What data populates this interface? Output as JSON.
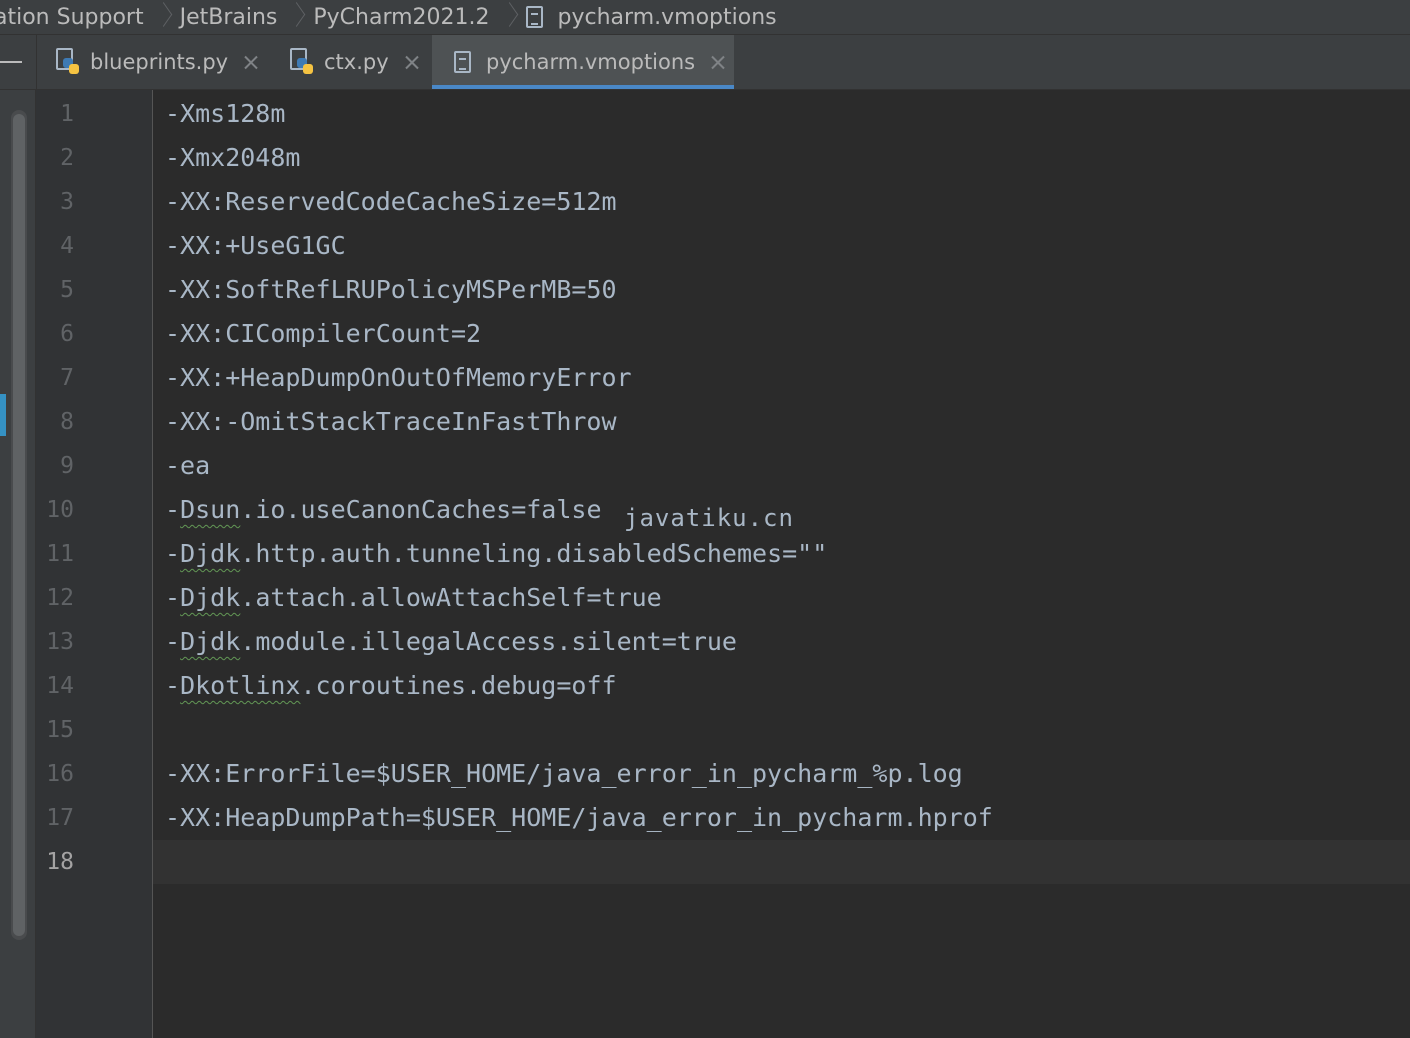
{
  "breadcrumb": {
    "items": [
      "ation Support",
      "JetBrains",
      "PyCharm2021.2",
      "pycharm.vmoptions"
    ]
  },
  "tabs": [
    {
      "label": "blueprints.py",
      "icon": "python-file-icon",
      "active": false
    },
    {
      "label": "ctx.py",
      "icon": "python-file-icon",
      "active": false
    },
    {
      "label": "pycharm.vmoptions",
      "icon": "text-file-icon",
      "active": true
    }
  ],
  "editor": {
    "current_line": "18",
    "line_numbers": [
      "1",
      "2",
      "3",
      "4",
      "5",
      "6",
      "7",
      "8",
      "9",
      "10",
      "11",
      "12",
      "13",
      "14",
      "15",
      "16",
      "17",
      "18"
    ],
    "lines": [
      {
        "prefix": "-Xms128m",
        "flagged": "",
        "rest": ""
      },
      {
        "prefix": "-Xmx2048m",
        "flagged": "",
        "rest": ""
      },
      {
        "prefix": "-XX:ReservedCodeCacheSize=512m",
        "flagged": "",
        "rest": ""
      },
      {
        "prefix": "-XX:+UseG1GC",
        "flagged": "",
        "rest": ""
      },
      {
        "prefix": "-XX:SoftRefLRUPolicyMSPerMB=50",
        "flagged": "",
        "rest": ""
      },
      {
        "prefix": "-XX:CICompilerCount=2",
        "flagged": "",
        "rest": ""
      },
      {
        "prefix": "-XX:+HeapDumpOnOutOfMemoryError",
        "flagged": "",
        "rest": ""
      },
      {
        "prefix": "-XX:-OmitStackTraceInFastThrow",
        "flagged": "",
        "rest": ""
      },
      {
        "prefix": "-ea",
        "flagged": "",
        "rest": ""
      },
      {
        "prefix": "-",
        "flagged": "Dsun",
        "rest": ".io.useCanonCaches=false"
      },
      {
        "prefix": "-",
        "flagged": "Djdk",
        "rest": ".http.auth.tunneling.disabledSchemes=\"\""
      },
      {
        "prefix": "-",
        "flagged": "Djdk",
        "rest": ".attach.allowAttachSelf=true"
      },
      {
        "prefix": "-",
        "flagged": "Djdk",
        "rest": ".module.illegalAccess.silent=true"
      },
      {
        "prefix": "-",
        "flagged": "Dkotlinx",
        "rest": ".coroutines.debug=off"
      },
      {
        "prefix": "",
        "flagged": "",
        "rest": ""
      },
      {
        "prefix": "-XX:ErrorFile=$USER_HOME/java_error_in_pycharm_%p.log",
        "flagged": "",
        "rest": ""
      },
      {
        "prefix": "-XX:HeapDumpPath=$USER_HOME/java_error_in_pycharm.hprof",
        "flagged": "",
        "rest": ""
      },
      {
        "prefix": "",
        "flagged": "",
        "rest": ""
      }
    ],
    "watermark": "javatiku.cn"
  },
  "colors": {
    "background": "#2b2b2b",
    "gutter": "#313335",
    "chrome": "#3c3f41",
    "text": "#a9b7c6",
    "line_number": "#606366",
    "active_tab_underline": "#4a88c7",
    "typo_underline": "#629755"
  }
}
